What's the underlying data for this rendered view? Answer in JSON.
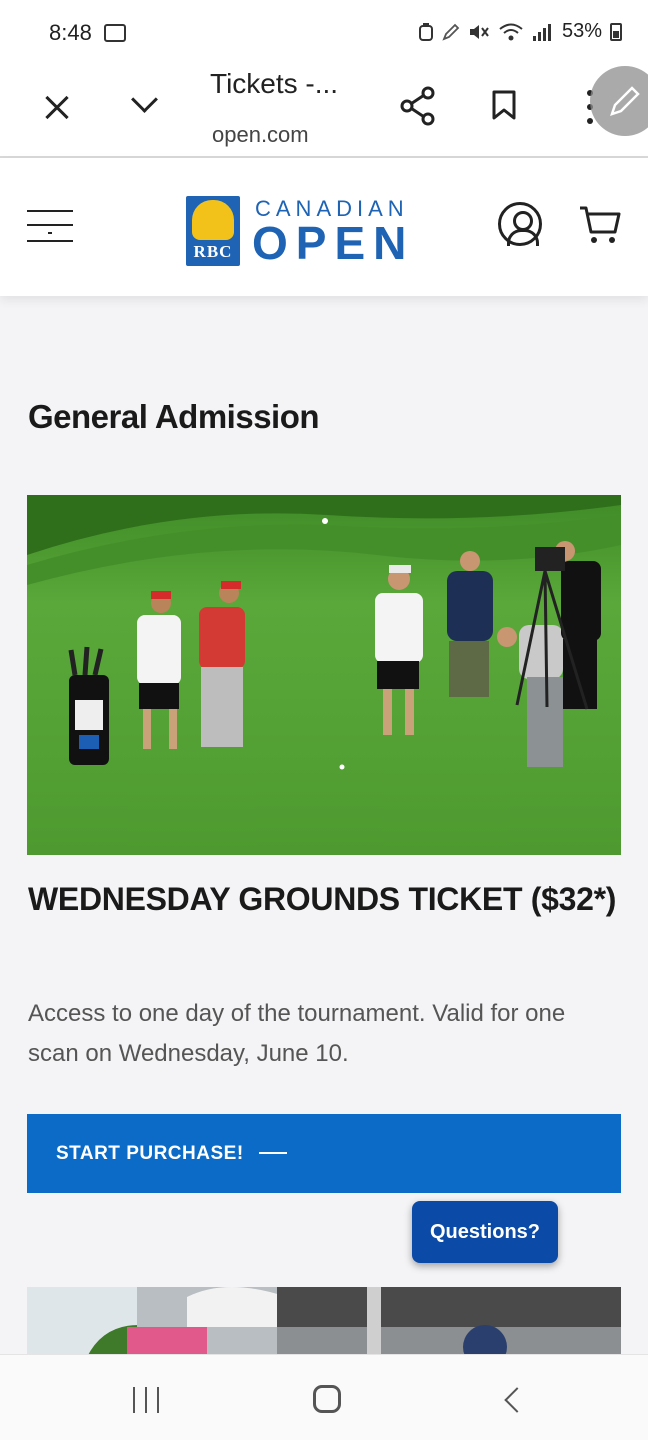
{
  "status_bar": {
    "time": "8:48",
    "battery": "53%",
    "icons": [
      "voicemail-icon",
      "recycle-icon",
      "pen-icon",
      "mute-icon",
      "wifi-icon",
      "signal-icon",
      "battery-icon"
    ]
  },
  "browser": {
    "tab_title": "Tickets -...",
    "url": "open.com",
    "icons": [
      "close-icon",
      "chevron-down-icon",
      "share-icon",
      "bookmark-icon",
      "more-icon",
      "edit-icon"
    ]
  },
  "site_header": {
    "logo_bank": "RBC",
    "logo_line1": "CANADIAN",
    "logo_line2": "OPEN",
    "icons": [
      "menu-icon",
      "account-icon",
      "cart-icon"
    ]
  },
  "content": {
    "section_title": "General Admission",
    "ticket_title": "WEDNESDAY GROUNDS TICKET ($32*)",
    "ticket_description": "Access to one day of the tournament. Valid for one scan on Wednesday, June 10.",
    "purchase_label": "START PURCHASE!",
    "questions_label": "Questions?"
  },
  "colors": {
    "brand_blue": "#1e63b4",
    "button_blue": "#0c6bc6",
    "questions_blue": "#0b4aa6",
    "logo_gold": "#f2c21b"
  },
  "nav_bar": {
    "icons": [
      "recent-apps-icon",
      "home-icon",
      "back-icon"
    ]
  }
}
